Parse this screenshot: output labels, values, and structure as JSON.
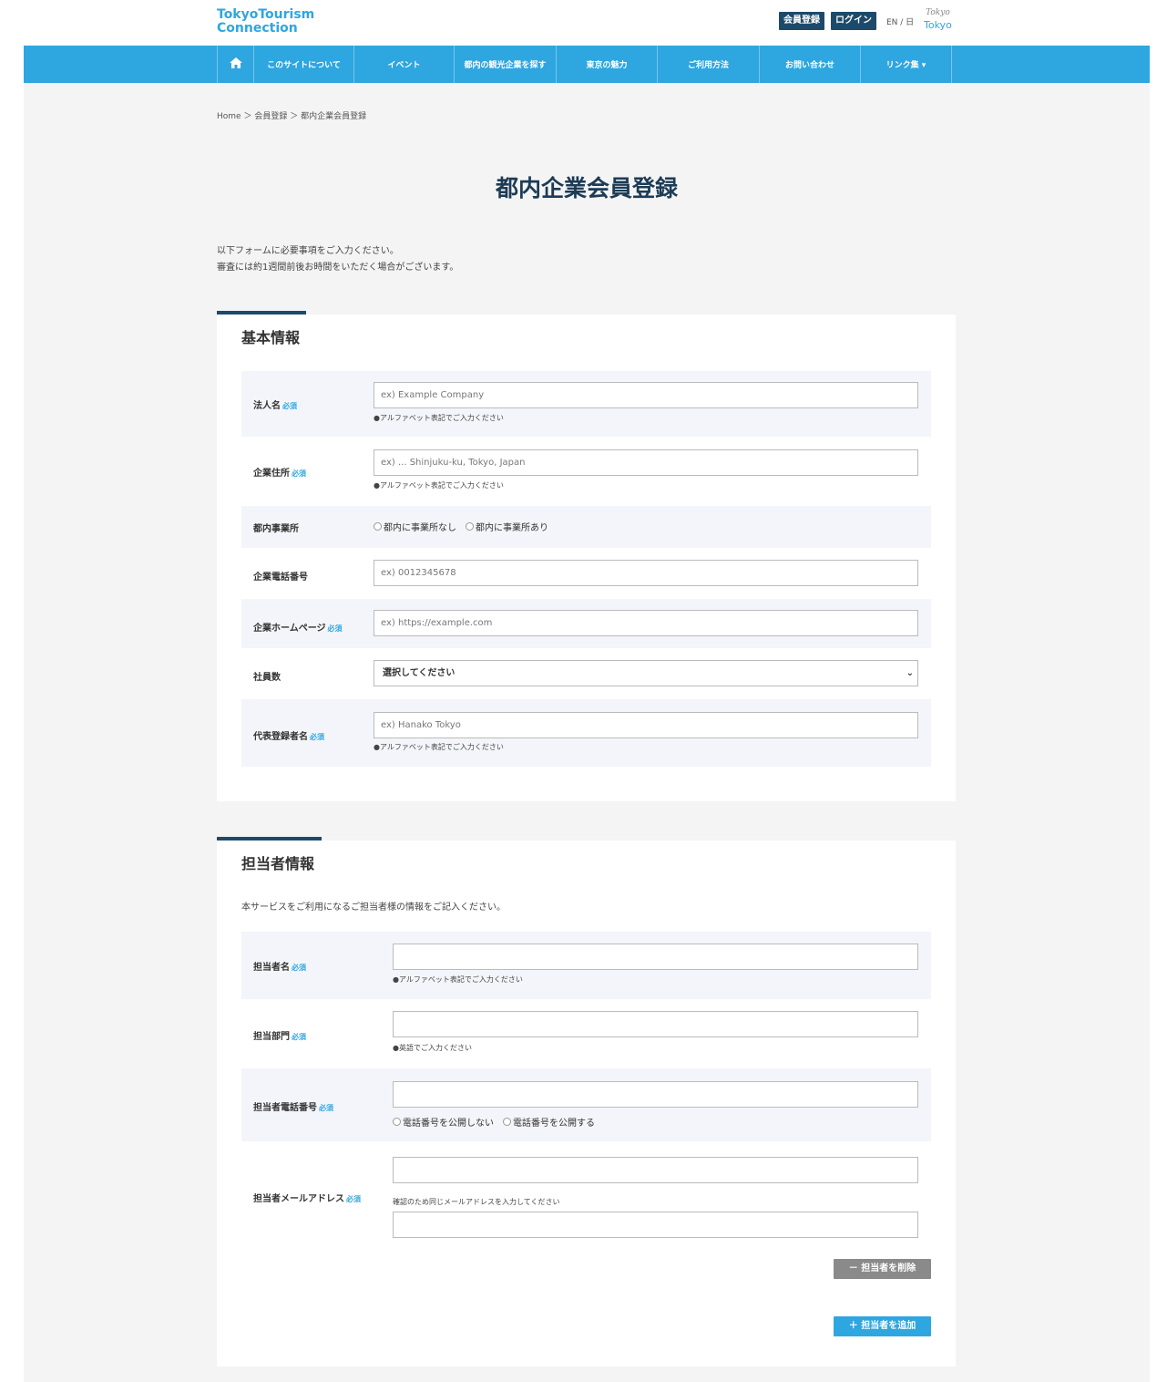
{
  "header": {
    "logo_line1": "TokyoTourism",
    "logo_line2": "Connection",
    "register_label": "会員登録",
    "login_label": "ログイン",
    "lang_label": "EN / 日",
    "tokyo_script": "Tokyo",
    "tokyo_label": "Tokyo"
  },
  "nav": {
    "items": [
      {
        "label": "このサイトについて"
      },
      {
        "label": "イベント"
      },
      {
        "label": "都内の観光企業を探す"
      },
      {
        "label": "東京の魅力"
      },
      {
        "label": "ご利用方法"
      },
      {
        "label": "お問い合わせ"
      },
      {
        "label": "リンク集 ▾"
      }
    ]
  },
  "breadcrumb": {
    "home": "Home",
    "sep": "＞",
    "level1": "会員登録",
    "current": "都内企業会員登録"
  },
  "page": {
    "title": "都内企業会員登録",
    "intro_line1": "以下フォームに必要事項をご入力ください。",
    "intro_line2": "審査には約1週間前後お時間をいただく場合がございます。"
  },
  "basic": {
    "title": "基本情報",
    "required": "必須",
    "company_name_label": "法人名",
    "company_name_placeholder": "ex) Example Company",
    "company_name_note": "●アルファベット表記でご入力ください",
    "address_label": "企業住所",
    "address_placeholder": "ex) ... Shinjuku-ku, Tokyo, Japan",
    "address_note": "●アルファベット表記でご入力ください",
    "office_label": "都内事業所",
    "office_option1": "都内に事業所なし",
    "office_option2": "都内に事業所あり",
    "phone_label": "企業電話番号",
    "phone_placeholder": "ex) 0012345678",
    "homepage_label": "企業ホームページ",
    "homepage_placeholder": "ex) https://example.com",
    "employees_label": "社員数",
    "employees_selected": "選択してください",
    "representative_label": "代表登録者名",
    "representative_placeholder": "ex) Hanako Tokyo",
    "representative_note": "●アルファベット表記でご入力ください"
  },
  "contact": {
    "title": "担当者情報",
    "description": "本サービスをご利用になるご担当者様の情報をご記入ください。",
    "required": "必須",
    "name_label": "担当者名",
    "name_note": "●アルファベット表記でご入力ください",
    "dept_label": "担当部門",
    "dept_note": "●英語でご入力ください",
    "phone_label": "担当者電話番号",
    "phone_option1": "電話番号を公開しない",
    "phone_option2": "電話番号を公開する",
    "email_label": "担当者メールアドレス",
    "email_note": "確認のため同じメールアドレスを入力してください",
    "delete_label": "担当者を削除",
    "add_label": "担当者を追加"
  },
  "icons": {
    "home": "home-icon",
    "minus": "minus-icon",
    "plus": "plus-icon",
    "chevron": "chevron-down-icon"
  },
  "colors": {
    "brand_blue": "#2ea6e0",
    "navy": "#1d4a6b",
    "page_bg": "#f4f4f4",
    "row_shade": "#f4f5fa"
  }
}
